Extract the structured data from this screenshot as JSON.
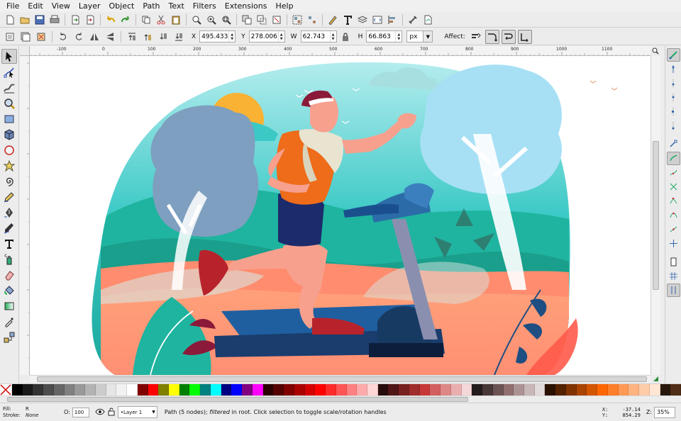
{
  "menu": [
    "File",
    "Edit",
    "View",
    "Layer",
    "Object",
    "Path",
    "Text",
    "Filters",
    "Extensions",
    "Help"
  ],
  "command_bar_icons": [
    "new-icon",
    "open-icon",
    "save-icon",
    "print-icon",
    "import-icon",
    "export-icon",
    "undo-icon",
    "redo-icon",
    "copy-icon",
    "cut-icon",
    "paste-icon",
    "zoom-selection-icon",
    "zoom-drawing-icon",
    "zoom-page-icon",
    "duplicate-icon",
    "clone-icon",
    "unlink-clone-icon",
    "group-icon",
    "ungroup-icon",
    "fill-stroke-icon",
    "text-font-icon",
    "layers-icon",
    "xml-editor-icon",
    "align-icon",
    "preferences-icon",
    "document-properties-icon"
  ],
  "selector_controls": {
    "x_label": "X",
    "x_value": "495.433",
    "y_label": "Y",
    "y_value": "278.006",
    "w_label": "W",
    "w_value": "62.743",
    "h_label": "H",
    "h_value": "66.863",
    "unit": "px",
    "affect_label": "Affect:"
  },
  "ruler_ticks": [
    "-100",
    "0",
    "100",
    "200",
    "300",
    "400",
    "500",
    "600",
    "700",
    "800",
    "900",
    "1000",
    "1100"
  ],
  "tools": [
    "selector-tool",
    "node-tool",
    "tweak-tool",
    "zoom-tool",
    "rectangle-tool",
    "3d-box-tool",
    "ellipse-tool",
    "star-tool",
    "spiral-tool",
    "pencil-tool",
    "pen-tool",
    "calligraphy-tool",
    "text-tool",
    "spray-tool",
    "eraser-tool",
    "bucket-tool",
    "gradient-tool",
    "dropper-tool",
    "connector-tool"
  ],
  "palette_colors": [
    "#000000",
    "#1a1a1a",
    "#333333",
    "#4d4d4d",
    "#666666",
    "#808080",
    "#999999",
    "#b3b3b3",
    "#cccccc",
    "#e6e6e6",
    "#f2f2f2",
    "#ffffff",
    "#800000",
    "#ff0000",
    "#808000",
    "#ffff00",
    "#008000",
    "#00ff00",
    "#008080",
    "#00ffff",
    "#000080",
    "#0000ff",
    "#800080",
    "#ff00ff",
    "#2b0000",
    "#550000",
    "#800000",
    "#aa0000",
    "#d40000",
    "#ff0000",
    "#ff2a2a",
    "#ff5555",
    "#ff8080",
    "#ffaaaa",
    "#ffd5d5",
    "#280b0b",
    "#501616",
    "#782121",
    "#a02c2c",
    "#c83737",
    "#d35f5f",
    "#de8787",
    "#e9afaf",
    "#f4d7d7",
    "#241c1c",
    "#483737",
    "#6c5353",
    "#916f6f",
    "#ac9393",
    "#c8b7b7",
    "#e3dbdb",
    "#2b1100",
    "#552200",
    "#803300",
    "#aa4400",
    "#d45500",
    "#ff6600",
    "#ff7f2a",
    "#ff9955",
    "#ffb380",
    "#ffccaa",
    "#ffe6d5",
    "#28170b",
    "#502d16"
  ],
  "status": {
    "fill_label": "Fill:",
    "fill_value": "R",
    "stroke_label": "Stroke:",
    "stroke_value": "None",
    "opacity_label": "O:",
    "opacity_value": "100",
    "layer_name": "•Layer 1",
    "message_prefix": "Path (5 nodes); ",
    "message_italic": "filtered",
    "message_suffix": " in root. Click selection to toggle scale/rotation handles",
    "x_label": "X:",
    "x_value": "-37.14",
    "y_label": "Y:",
    "y_value": "854.29",
    "zoom_label": "Z:",
    "zoom_value": "35%"
  }
}
